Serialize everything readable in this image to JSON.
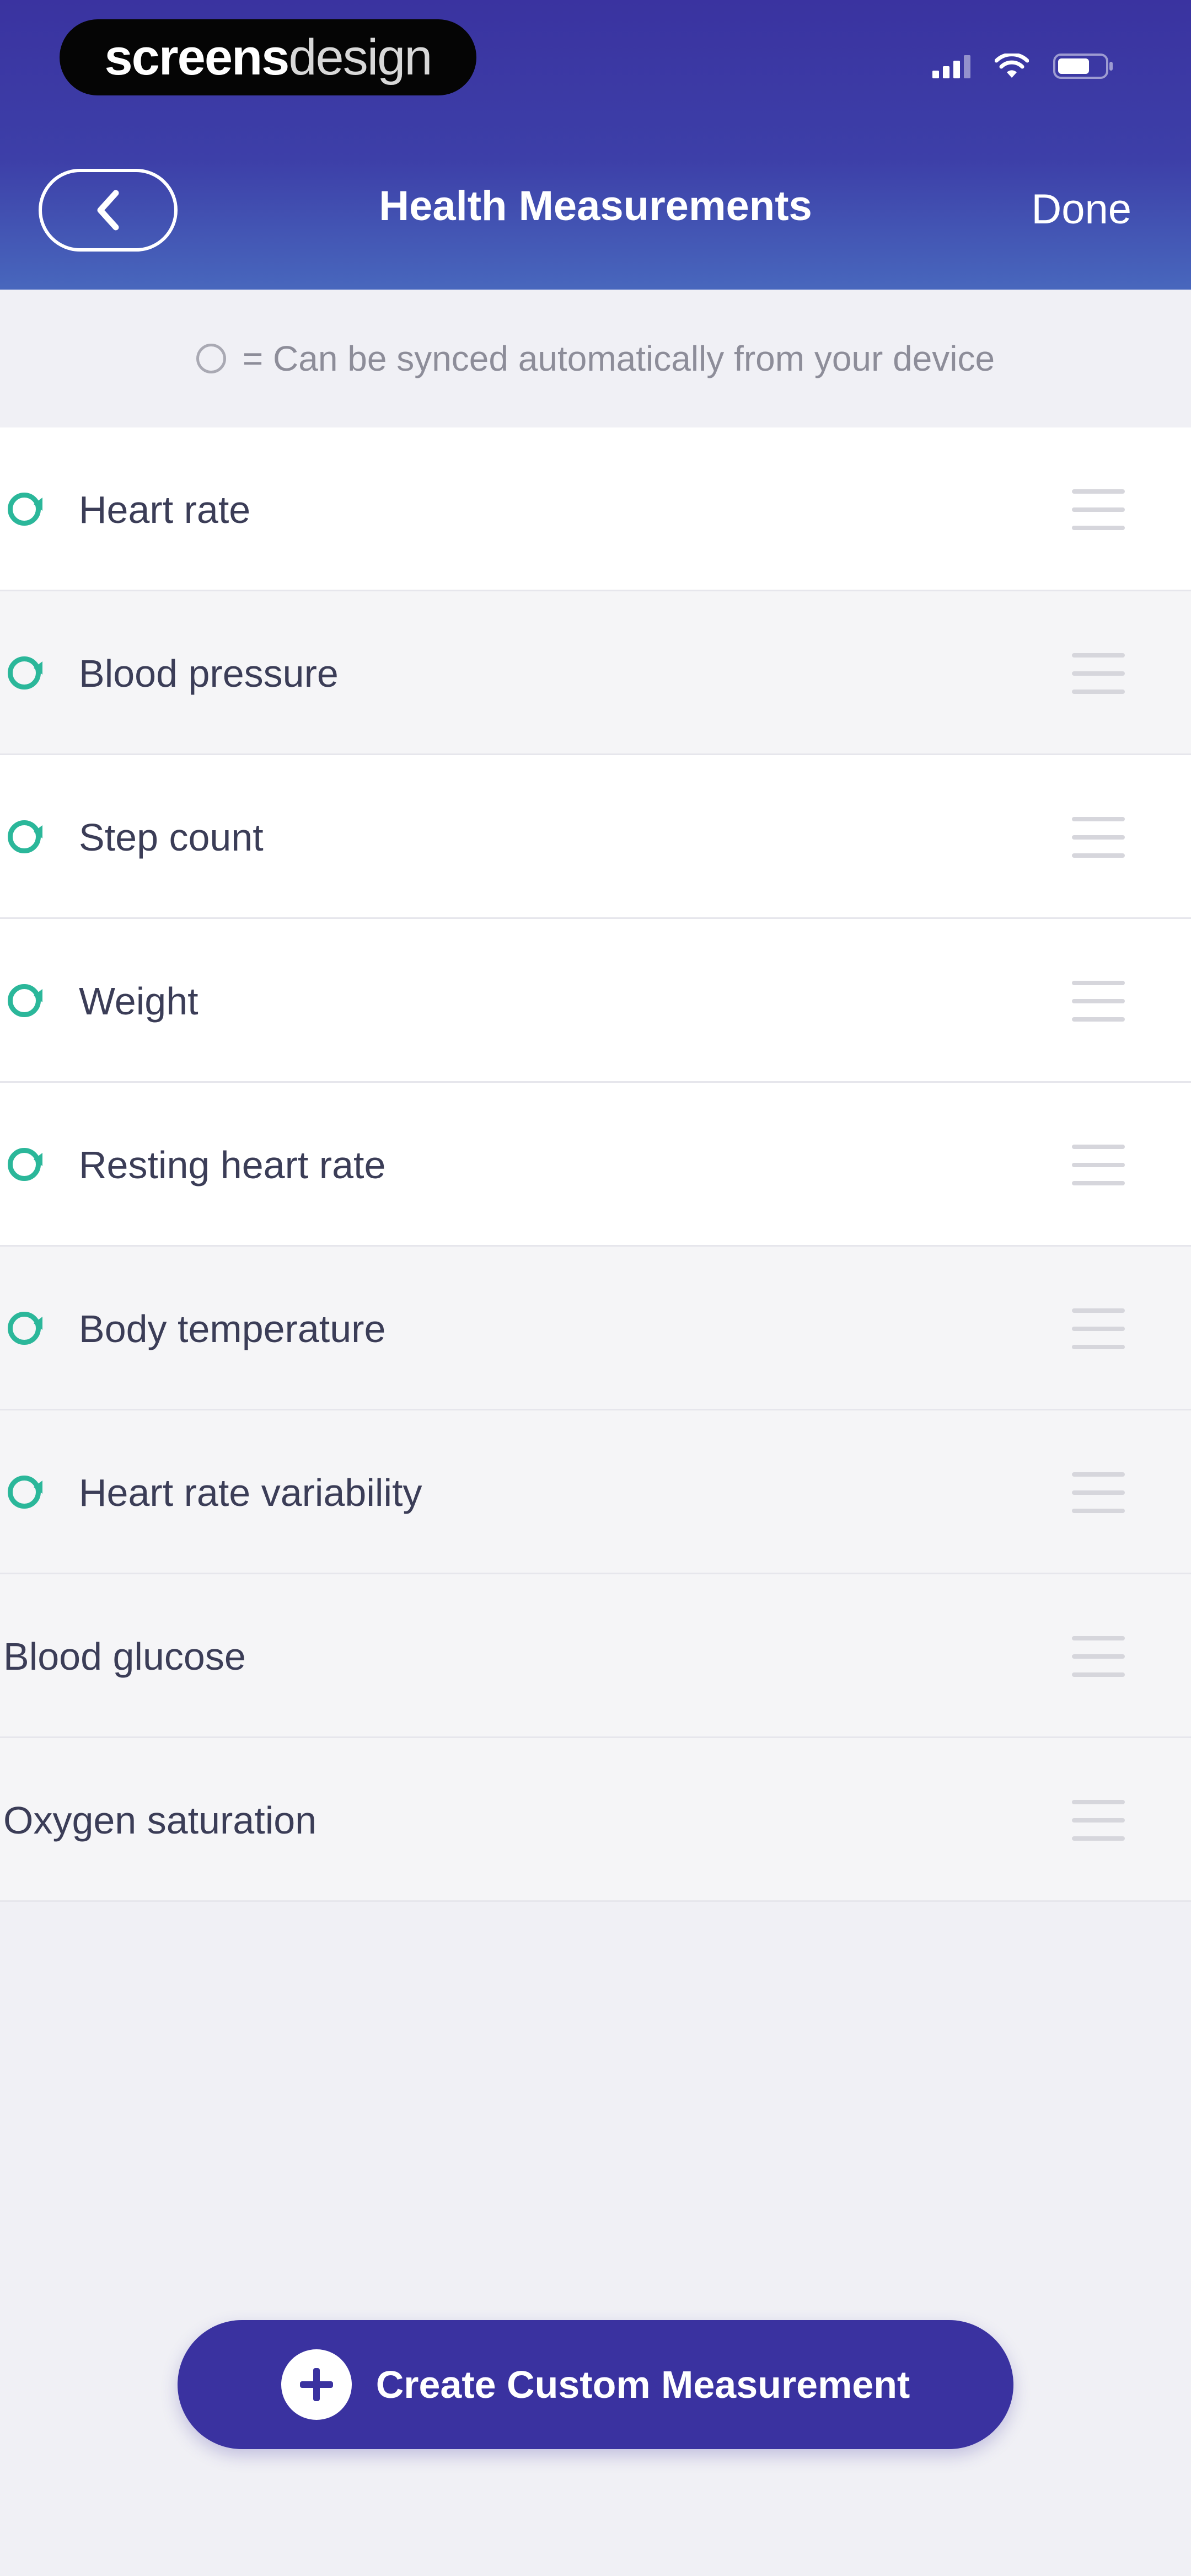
{
  "watermark": {
    "part1": "screens",
    "part2": "design"
  },
  "header": {
    "title": "Health Measurements",
    "done_label": "Done"
  },
  "legend": {
    "text": "= Can be synced automatically from your device"
  },
  "measurements": [
    {
      "label": "Heart rate",
      "syncable": true,
      "highlight": true
    },
    {
      "label": "Blood pressure",
      "syncable": true,
      "highlight": false
    },
    {
      "label": "Step count",
      "syncable": true,
      "highlight": true
    },
    {
      "label": "Weight",
      "syncable": true,
      "highlight": true
    },
    {
      "label": "Resting heart rate",
      "syncable": true,
      "highlight": true
    },
    {
      "label": "Body temperature",
      "syncable": true,
      "highlight": false
    },
    {
      "label": "Heart rate variability",
      "syncable": true,
      "highlight": false
    },
    {
      "label": "Blood glucose",
      "syncable": false,
      "highlight": false
    },
    {
      "label": "Oxygen saturation",
      "syncable": false,
      "highlight": false
    }
  ],
  "create_button": {
    "label": "Create Custom Measurement"
  },
  "colors": {
    "primary": "#3a32a0",
    "sync_accent": "#2bb79a",
    "text": "#3b3d57"
  }
}
